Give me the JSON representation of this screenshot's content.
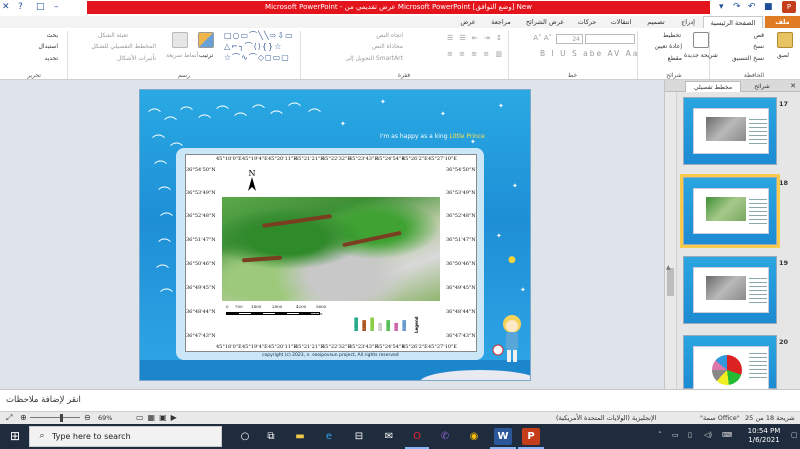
{
  "window": {
    "title": "Microsoft PowerPoint - عرض تقديمي من Microsoft PowerPoint [وضع التوافق] New",
    "qat_icons": [
      "save-icon",
      "undo-icon",
      "redo-icon"
    ],
    "controls": [
      "minimize-icon",
      "maximize-icon",
      "close-icon",
      "help-icon"
    ]
  },
  "ribbon_tabs": [
    "ملف",
    "الصفحة الرئيسية",
    "إدراج",
    "تصميم",
    "انتقالات",
    "حركات",
    "عرض الشرائح",
    "مراجعة",
    "عرض"
  ],
  "ribbon": {
    "groups": {
      "clipboard": "الحافظة",
      "slides": "شرائح",
      "font": "خط",
      "paragraph": "فقرة",
      "drawing": "رسم",
      "editing": "تحرير"
    },
    "clipboard": {
      "paste": "لصق",
      "cut": "قص",
      "copy": "نسخ",
      "format_painter": "نسخ التنسيق"
    },
    "slides": {
      "new_slide": "شريحة جديدة",
      "layout": "تخطيط",
      "reset": "إعادة تعيين",
      "section": "مقطع"
    },
    "font": {
      "font_name": "",
      "font_size": "24"
    },
    "paragraph": {
      "text_direction": "اتجاه النص",
      "align_text": "محاذاة النص",
      "convert_smartart": "التحويل إلى SmartArt"
    },
    "drawing": {
      "arrange": "ترتيب",
      "quick_styles": "أنماط سريعة",
      "shape_fill": "تعبئة الشكل",
      "shape_outline": "المخطط التفصيلي للشكل",
      "shape_effects": "تأثيرات الأشكال"
    },
    "editing": {
      "find": "بحث",
      "replace": "استبدال",
      "select": "تحديد"
    }
  },
  "slide": {
    "tagline": "I'm as happy as a king",
    "tagline_brand": "Little Prince",
    "copyright": "copyright (c) 2023, n. seoipovsun project, All rights reserved",
    "coords_top": [
      "45°18'0\"E",
      "45°19'4\"E",
      "45°20'11\"E",
      "45°21'21\"E",
      "45°22'32\"E",
      "45°23'43\"E",
      "45°24'54\"E",
      "45°26'2\"E",
      "45°27'10\"E"
    ],
    "coords_bottom": [
      "45°18'0\"E",
      "45°19'4\"E",
      "45°20'11\"E",
      "45°21'21\"E",
      "45°22'32\"E",
      "45°23'43\"E",
      "45°24'54\"E",
      "45°26'2\"E",
      "45°27'10\"E"
    ],
    "coords_left": [
      "36°54'50\"N",
      "36°53'49\"N",
      "36°52'48\"N",
      "36°51'47\"N",
      "36°50'46\"N",
      "36°49'45\"N",
      "36°48'44\"N",
      "36°47'43\"N"
    ],
    "coords_right": [
      "36°54'50\"N",
      "36°53'49\"N",
      "36°52'48\"N",
      "36°51'47\"N",
      "36°50'46\"N",
      "36°49'45\"N",
      "36°48'44\"N",
      "36°47'43\"N"
    ],
    "scale_labels": [
      "0",
      "700",
      "1400",
      "2800",
      "4200",
      "5600"
    ],
    "scale_unit": "Meters",
    "north_label": "N",
    "legend_title": "Legend"
  },
  "panel": {
    "tabs": [
      "شرائح",
      "مخطط تفصيلي"
    ],
    "thumbs": [
      {
        "num": "17",
        "kind": "gray"
      },
      {
        "num": "18",
        "kind": "green",
        "selected": true
      },
      {
        "num": "19",
        "kind": "gray"
      },
      {
        "num": "20",
        "kind": "pie"
      }
    ]
  },
  "notes_placeholder": "انقر لإضافة ملاحظات",
  "status": {
    "slide_info": "شريحة 18 من 25",
    "theme": "\"سمة Office\"",
    "language": "الإنجليزية (الولايات المتحدة الأمريكية)",
    "zoom": "69%"
  },
  "taskbar": {
    "search_placeholder": "Type here to search",
    "time": "10:54 PM",
    "date": "1/6/2021",
    "apps": [
      "task-view-icon",
      "file-explorer-icon",
      "edge-icon",
      "store-icon",
      "opera-icon",
      "viber-icon",
      "chrome-icon",
      "word-icon",
      "powerpoint-icon"
    ]
  }
}
